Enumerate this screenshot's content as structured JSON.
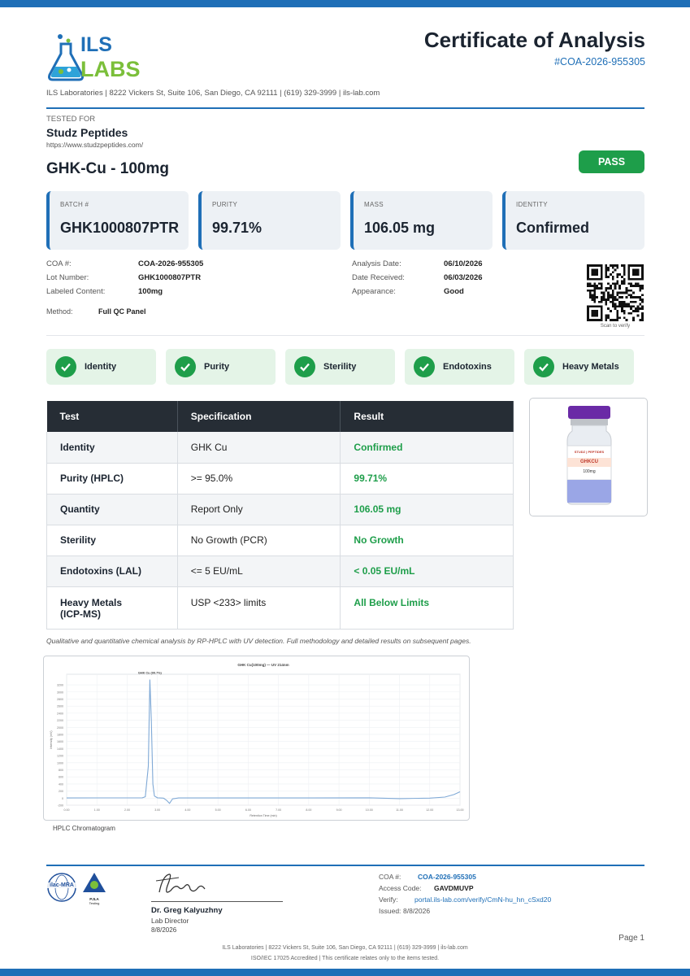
{
  "logo": {
    "line1": "ILS",
    "line2": "LABS"
  },
  "header": {
    "title": "Certificate of Analysis",
    "coa_id": "#COA-2026-955305"
  },
  "address": "ILS Laboratories  |  8222 Vickers St, Suite 106, San Diego, CA 92111  |  (619) 329-3999  |  ils-lab.com",
  "client": {
    "label": "TESTED FOR",
    "name": "Studz Peptides",
    "url": "https://www.studzpeptides.com/"
  },
  "product": "GHK-Cu - 100mg",
  "status": "PASS",
  "cards": [
    {
      "label": "BATCH #",
      "value": "GHK1000807PTR"
    },
    {
      "label": "PURITY",
      "value": "99.71%"
    },
    {
      "label": "MASS",
      "value": "106.05 mg"
    },
    {
      "label": "IDENTITY",
      "value": "Confirmed"
    }
  ],
  "meta_left": [
    {
      "k": "COA #:",
      "v": "COA-2026-955305"
    },
    {
      "k": "Lot Number:",
      "v": "GHK1000807PTR"
    },
    {
      "k": "Labeled Content:",
      "v": "100mg"
    }
  ],
  "meta_right": [
    {
      "k": "Analysis Date:",
      "v": "06/10/2026"
    },
    {
      "k": "Date Received:",
      "v": "06/03/2026"
    },
    {
      "k": "Appearance:",
      "v": "Good"
    }
  ],
  "method": {
    "k": "Method:",
    "v": "Full QC Panel"
  },
  "qr_caption": "Scan to verify",
  "checks": [
    "Identity",
    "Purity",
    "Sterility",
    "Endotoxins",
    "Heavy Metals"
  ],
  "table": {
    "headers": [
      "Test",
      "Specification",
      "Result"
    ],
    "rows": [
      {
        "test": "Identity",
        "spec": "GHK Cu",
        "result": "Confirmed"
      },
      {
        "test": "Purity (HPLC)",
        "spec": ">= 95.0%",
        "result": "99.71%"
      },
      {
        "test": "Quantity",
        "spec": "Report Only",
        "result": "106.05 mg"
      },
      {
        "test": "Sterility",
        "spec": "No Growth (PCR)",
        "result": "No Growth"
      },
      {
        "test": "Endotoxins (LAL)",
        "spec": "<= 5 EU/mL",
        "result": "< 0.05 EU/mL"
      },
      {
        "test": "Heavy Metals\n(ICP-MS)",
        "spec": "USP <233> limits",
        "result": "All Below Limits"
      }
    ]
  },
  "vial": {
    "brand": "STUDZ | PEPTIDES",
    "name": "GHKCU",
    "dose": "100mg"
  },
  "note": "Qualitative and quantitative chemical analysis by RP-HPLC with UV detection. Full methodology and detailed results on subsequent pages.",
  "chart_data": {
    "type": "line",
    "title": "GHK Cu(100mg) — UV 214nm",
    "xlabel": "Retention Time (min)",
    "ylabel": "Intensity (mV)",
    "peak_label": "GHK Cu (99.7%)",
    "xlim": [
      0,
      13
    ],
    "ylim": [
      -200,
      3500
    ],
    "x_ticks": [
      0,
      1,
      2,
      3,
      4,
      5,
      6,
      7,
      8,
      9,
      10,
      11,
      12,
      13
    ],
    "y_ticks": [
      -200,
      0,
      200,
      400,
      600,
      800,
      1000,
      1200,
      1400,
      1600,
      1800,
      2000,
      2200,
      2400,
      2600,
      2800,
      3000,
      3200
    ],
    "series": [
      {
        "x": [
          0,
          2.5,
          2.6,
          2.7,
          2.75,
          2.8,
          2.85,
          2.9,
          3.0,
          3.2,
          3.3,
          3.4,
          3.5,
          3.7,
          4,
          6,
          8,
          10,
          11,
          12,
          12.5,
          12.8,
          13
        ],
        "y": [
          5,
          10,
          40,
          900,
          3350,
          2200,
          400,
          60,
          10,
          0,
          -60,
          -150,
          -20,
          5,
          5,
          5,
          5,
          10,
          -15,
          0,
          30,
          100,
          180
        ]
      }
    ],
    "grid": true,
    "color": "#7fa9d6"
  },
  "chart_caption": "HPLC Chromatogram",
  "signature": {
    "name": "Dr. Greg Kalyuzhny",
    "role": "Lab Director",
    "date": "8/8/2026"
  },
  "accred": {
    "ilac": "ilac-MRA",
    "pjla_line1": "PJLA",
    "pjla_line2": "Testing"
  },
  "footer_info": [
    {
      "k": "COA #:",
      "v": "COA-2026-955305"
    },
    {
      "k": "Access Code:",
      "v": "GAVDMUVP"
    },
    {
      "k": "Verify:",
      "v": "portal.ils-lab.com/verify/CmN-hu_hn_cSxd20"
    },
    {
      "k": "Issued:",
      "v": "8/8/2026"
    }
  ],
  "page": "Page 1",
  "footer1": "ILS Laboratories  |  8222 Vickers St, Suite 106, San Diego, CA 92111  |  (619) 329-3999  |  ils-lab.com",
  "footer2": "ISO/IEC 17025 Accredited  |  This certificate relates only to the items tested."
}
